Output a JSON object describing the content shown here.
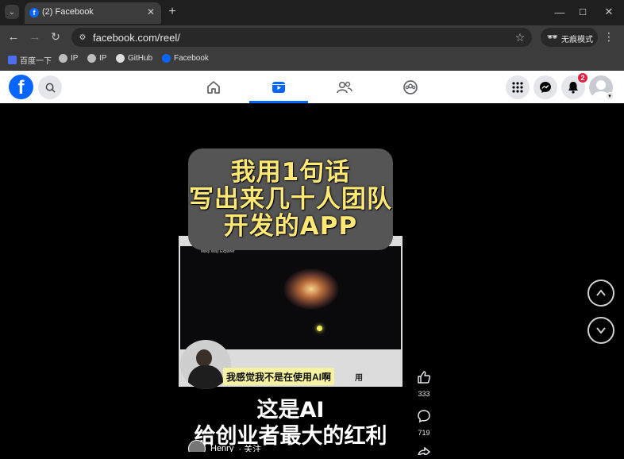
{
  "browser": {
    "tab_title": "(2) Facebook",
    "new_tab": "+",
    "url": "facebook.com/reel/",
    "incognito_label": "无痕模式",
    "window_controls": [
      "minimize-icon",
      "maximize-icon",
      "close-icon"
    ],
    "bookmarks": [
      {
        "label": "百度一下",
        "icon": "baidu-icon"
      },
      {
        "label": "IP",
        "icon": "globe-icon"
      },
      {
        "label": "IP",
        "icon": "globe-icon"
      },
      {
        "label": "GitHub",
        "icon": "github-icon"
      },
      {
        "label": "Facebook",
        "icon": "facebook-icon"
      }
    ]
  },
  "fb": {
    "logo_letter": "f",
    "nav_tabs": [
      {
        "name": "home",
        "icon": "home-icon",
        "active": false
      },
      {
        "name": "reels",
        "icon": "reels-icon",
        "active": true
      },
      {
        "name": "friends",
        "icon": "friends-icon",
        "active": false
      },
      {
        "name": "groups",
        "icon": "groups-icon",
        "active": false
      }
    ],
    "notifications_count": "2",
    "accent_color": "#0866ff"
  },
  "reel": {
    "top_title": [
      "我用1句话",
      "写出来几十人团队",
      "开发的APP"
    ],
    "screen_title": "Milky Way Explorer",
    "subtitle": "我感觉我不是在使用AI啊",
    "subtitle_cut": "用",
    "bottom_title": [
      "这是AI",
      "给创业者最大的红利"
    ],
    "author": "Henry",
    "follow": "· 关注",
    "likes": "333",
    "comments": "719"
  }
}
